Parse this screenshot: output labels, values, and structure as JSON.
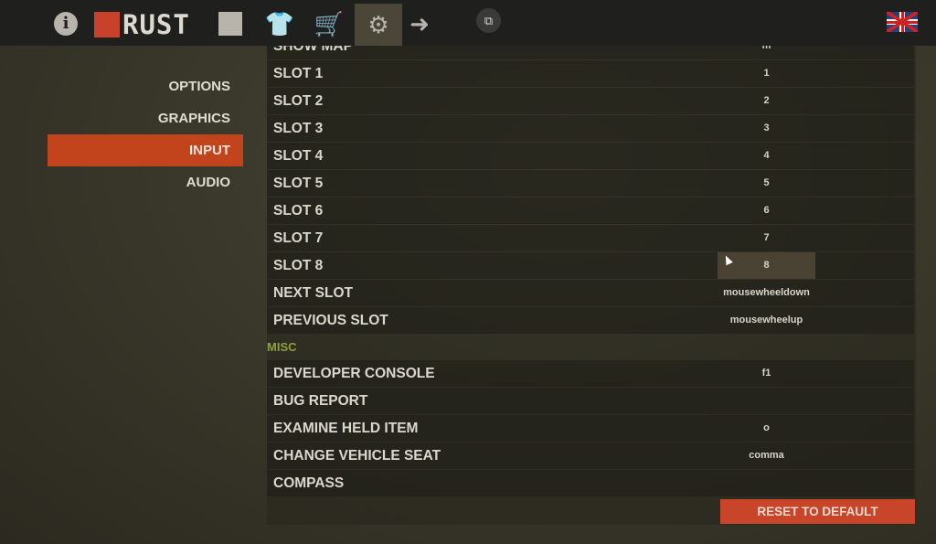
{
  "topbar": {
    "logo_text": "RUST",
    "icons": [
      "info-icon",
      "rust-logo",
      "inventory-icon",
      "shirt-icon",
      "store-cart-icon",
      "settings-gear-icon",
      "exit-icon",
      "popout-icon",
      "uk-flag-icon"
    ]
  },
  "sidebar": {
    "items": [
      {
        "label": "OPTIONS"
      },
      {
        "label": "GRAPHICS"
      },
      {
        "label": "INPUT",
        "active": true
      },
      {
        "label": "AUDIO"
      }
    ]
  },
  "bindings": [
    {
      "label": "SHOW MAP",
      "key": "m"
    },
    {
      "label": "SLOT 1",
      "key": "1"
    },
    {
      "label": "SLOT 2",
      "key": "2"
    },
    {
      "label": "SLOT 3",
      "key": "3"
    },
    {
      "label": "SLOT 4",
      "key": "4"
    },
    {
      "label": "SLOT 5",
      "key": "5"
    },
    {
      "label": "SLOT 6",
      "key": "6"
    },
    {
      "label": "SLOT 7",
      "key": "7"
    },
    {
      "label": "SLOT 8",
      "key": "8"
    },
    {
      "label": "NEXT SLOT",
      "key": "mousewheeldown"
    },
    {
      "label": "PREVIOUS SLOT",
      "key": "mousewheelup"
    }
  ],
  "misc": {
    "title": "MISC",
    "bindings": [
      {
        "label": "DEVELOPER CONSOLE",
        "key": "f1"
      },
      {
        "label": "BUG REPORT",
        "key": ""
      },
      {
        "label": "EXAMINE HELD ITEM",
        "key": "o"
      },
      {
        "label": "CHANGE VEHICLE SEAT",
        "key": "comma"
      },
      {
        "label": "COMPASS",
        "key": ""
      }
    ]
  },
  "reset_label": "RESET TO DEFAULT",
  "colors": {
    "accent": "#c1441c",
    "misc_header": "#8ea13a",
    "topbar": "#1f201d"
  }
}
